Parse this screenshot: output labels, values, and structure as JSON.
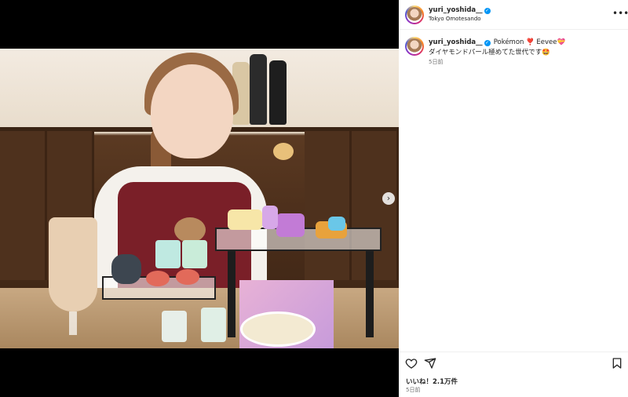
{
  "post": {
    "username": "yuri_yoshida__",
    "location": "Tokyo Omotesando",
    "caption_tags": "Pokémon ❣️ Eevee",
    "caption_emoji_1": "💝",
    "caption_text": "ダイヤモンドパール極めてた世代です",
    "caption_emoji_2": "🤩",
    "caption_time": "5日前",
    "likes": "いいね！2.1万件",
    "post_time": "5日前"
  },
  "icons": {
    "verified": "verified-badge-icon",
    "more": "more-options-icon",
    "like": "heart-icon",
    "share": "share-icon",
    "save": "bookmark-icon",
    "next": "chevron-right-icon"
  },
  "colors": {
    "verified_blue": "#0095f6",
    "secondary_text": "#737373",
    "divider": "#efefef"
  }
}
